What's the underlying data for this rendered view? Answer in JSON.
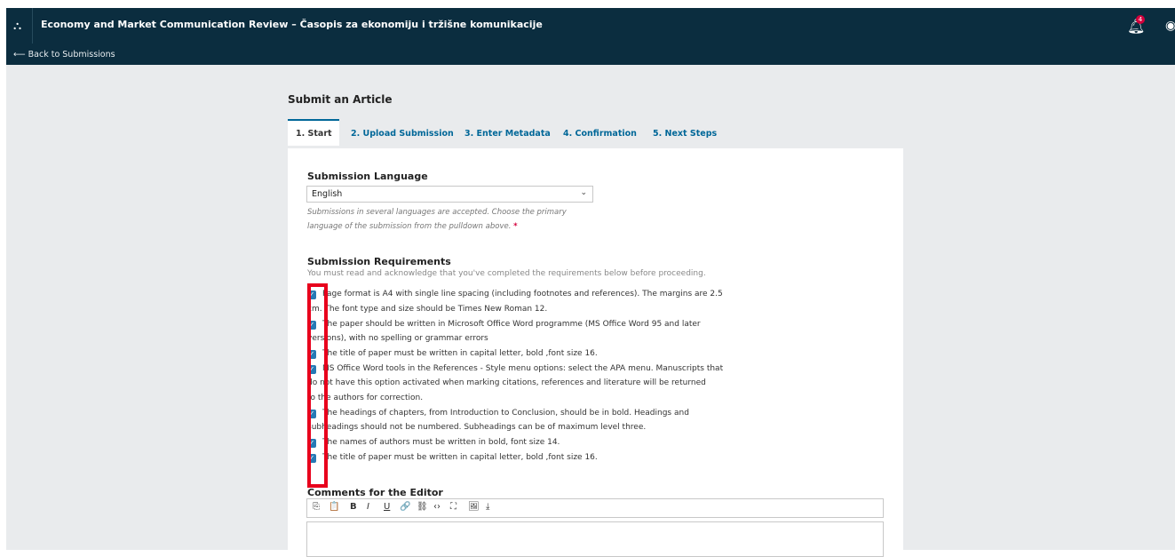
{
  "header": {
    "journal_title": "Economy and Market Communication Review – Časopis za ekonomiju i tržišne komunikacije",
    "back_link": "⟵ Back to Submissions",
    "notification_count": "4",
    "icons": [
      "sitemap-icon",
      "bell-icon",
      "user-icon"
    ]
  },
  "page": {
    "title": "Submit an Article"
  },
  "tabs": [
    {
      "label": "1. Start"
    },
    {
      "label": "2. Upload Submission"
    },
    {
      "label": "3. Enter Metadata"
    },
    {
      "label": "4. Confirmation"
    },
    {
      "label": "5. Next Steps"
    }
  ],
  "language": {
    "heading": "Submission Language",
    "selected": "English",
    "help_line1": "Submissions in several languages are accepted. Choose the primary",
    "help_line2": "language of the submission from the pulldown above.",
    "required_mark": "*"
  },
  "requirements": {
    "heading": "Submission Requirements",
    "description": "You must read and acknowledge that you've completed the requirements below before proceeding.",
    "lines": [
      "Page format is A4 with single line spacing (including footnotes and references). The margins are 2.5",
      "cm. The font type and size should be Times New Roman 12.",
      "The paper should be written in Microsoft Office Word programme (MS Office Word 95 and later",
      "versions), with no spelling or grammar errors",
      "The title of paper must be written in capital letter, bold ,font size 16.",
      "MS Office Word tools in the References - Style menu options: select the APA menu. Manuscripts that",
      "do not have this option activated when marking citations, references and literature will be returned",
      "to the authors for correction.",
      "The headings of chapters, from Introduction to Conclusion, should be in bold. Headings and",
      "subheadings should not be numbered. Subheadings can be of maximum level three.",
      "The names of authors must be written in bold, font size 14.",
      "The title of paper must be written in capital letter, bold ,font size 16."
    ],
    "checked": [
      true,
      true,
      true,
      true,
      true,
      true
    ]
  },
  "comments": {
    "heading": "Comments for the Editor",
    "toolbar_icons": [
      "copy-icon",
      "paste-icon",
      "bold-icon",
      "italic-icon",
      "underline-icon",
      "link-icon",
      "unlink-icon",
      "code-icon",
      "fullscreen-icon",
      "image-icon",
      "upload-icon"
    ],
    "toolbar_glyphs": {
      "copy": "⎘",
      "paste": "📋",
      "bold": "B",
      "italic": "I",
      "underline": "U",
      "link": "🔗",
      "unlink": "⛓",
      "code": "‹›",
      "fullscreen": "⛶",
      "image": "🖼",
      "upload": "⤓"
    }
  },
  "colors": {
    "header_bg": "#0b2d3f",
    "accent": "#006798",
    "checkbox": "#2679b5",
    "highlight_box": "#e8001c",
    "required": "#d4003c"
  }
}
